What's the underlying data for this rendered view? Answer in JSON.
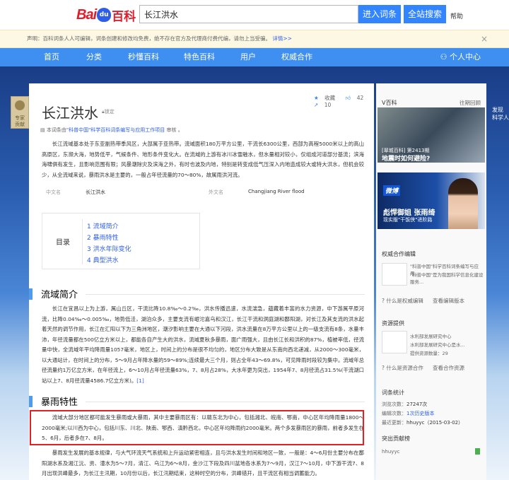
{
  "header": {
    "logo_bai": "Bai",
    "logo_du": "du",
    "logo_baike": "百科",
    "search_value": "长江洪水",
    "btn_enter": "进入词条",
    "btn_all": "全站搜索",
    "help": "帮助"
  },
  "notice": {
    "text": "声明：百科词条人人可编辑，词条创建和修改均免费，绝不存在官方及代理商付费代编，请勿上当受骗。",
    "details": "详情>>",
    "close": "×"
  },
  "nav": {
    "items": [
      "首页",
      "分类",
      "秒懂百科",
      "特色百科",
      "用户",
      "权威合作"
    ],
    "user_center": "个人中心"
  },
  "side_tab": {
    "line1": "专家",
    "line2": "贡献"
  },
  "right_edge": {
    "line1": "发现",
    "line2": "科学人"
  },
  "article": {
    "title": "长江洪水",
    "lock": "锁定",
    "collect": "收藏",
    "likes": "42",
    "shares": "10",
    "source_prefix": "本词条由",
    "source_org": "\"科普中国\"科学百科词条编写与应用工作项目",
    "source_suffix": " 审核 。",
    "intro": "长江流域基本处于东亚副热带季风区，大部属于亚热带。流域面积180万平方公里，干流长6300公里，西部为高程5000米以上的高山高原区，东濒大海，地势低平，气候条件、地形条件变化大。在流域的上游有冰川冰雪融水，但水量相对较小，仅组成河道部分基流；滨海海啸俱有发生，且影响范围有限；风暴潮除灾及滨海之外，有时也波及内地，特别是转变成低气压深入内地造成较大或特大洪水，但机会较少，从全流域来说，暴雨洪水是主要的，一般占年径流量的70～80%，故属雨洪河流。",
    "info": {
      "k1": "中文名",
      "v1": "长江洪水",
      "k2": "外文名",
      "v2": "Changjiang River flood"
    },
    "toc": {
      "label": "目录",
      "items": [
        "1  流域简介",
        "2  暴雨特性",
        "3  洪水年际变化",
        "4  典型洪水"
      ]
    },
    "sec1_title": "流域简介",
    "sec1_text": "长江在宜昌以上为上游，属山丘区，干流比降10.8‰～0.2‰，洪水传播迅速，水流湍急，蕴藏着丰富的水力资源，中下游属平原河流，比降0.04‰～0.005‰，地势低洼，湖泊众多，主要支流有岷沱嘉乌和汉江，长江干流和洞庭湖和鄱阳湖，对长江及其支流的洪水起着天然的调节作用，长江在汇阳以下为三角洲地区，潮汐影响主要在大通以下河段，洪水流量在8万平方公里以上的一级支流有8条，水量丰沛，年径流量都在500亿立方米以上，都能各自产生大的洪水，流域夏秋多暴雨，面广雨强大，且由长江长和洪积的87%，植被率低，径流量中快，全流域年平均降雨量1057毫米，地区上，时间上的分布是很不均匀的，地区分布大致是从东南向西北递减，从2000～300毫米，以大通站计，在时间上的分布，5～9月占年降水量的59～89%;连续最大三个月，则占全年43～69.8%，可见降雨时段较为集中。流域年总径流量约1万亿立方米，在年径流上，6～10月占年径流量63%，7、8月占28%，大水年更为突出，1954年7、8月径流占31.5%(干流湖口站以上7、8月径流量4586.7亿立方米)。",
    "sec1_ref": "[1]",
    "sec2_title": "暴雨特性",
    "sec2_highlight": "流域大部分地区都可能发生暴雨或大暴雨，其中主要暴雨区有：以赣东北为中心，包括湘北、皖南、鄂南，中心区年均降雨量1800～2000毫米;以川西为中心，包括川东、川北、陕南、鄂西、滇黔西北，中心区年均降雨约2000毫米。两个多发暴雨区的暴雨，前者多发生在5、6月，后者多在7、8月。",
    "sec2_text": "暴雨发生发展的基本规律，与大气环流天气系统和上升运动紧密相连，且与洪水发生时间和地区一致，一般是：4～6月份主要分布在鄱阳湖水系及湘江沅、资、澧水为5～7月，清江、乌江为6～8月，金沙江下段及四川盆地各水系为7～9月，汉江7～10月，中下游干流7、8月出现洪峰最多，为长江主汛期，10月份以后，长江汛期结束，这种时空的分布，洪峰错开，且干流区有相当调蓄能力。"
  },
  "right": {
    "vbaike": "V百科",
    "past": "往期回顾",
    "video_tag": "[翠城百科] 第2413期",
    "video_caption": "地震时如何避险?",
    "ad_logo": "微博",
    "ad_line1": "彪悍御姐 张雨绮",
    "ad_line2": "现实版\"干饭侠\"进阶路",
    "auth_head": "权威合作编辑",
    "auth_name": "\"科普中国\"科学百科词条编写与应用...",
    "auth_desc": "\"科普中国\"是为我国科学信息化建设服务...",
    "auth_what": "什么是权威编辑",
    "auth_view": "查看编辑版本",
    "res_head": "资源提供",
    "res_name": "水利部发展研究中心",
    "res_desc": "水利部发展研究中心是水...",
    "res_count_lbl": "提供资源数量：",
    "res_count": "29",
    "res_what": "什么是资源合作",
    "res_view": "查看合作资源",
    "stats_head": "词条统计",
    "views_lbl": "浏览次数：",
    "views": "27247次",
    "edits_lbl": "编辑次数：",
    "edits": "1次历史版本",
    "last_lbl": "最近更新：",
    "last": "hhuyyc（2015-03-02）",
    "contrib_head": "突出贡献榜",
    "contrib_user": "hhuyyc"
  }
}
